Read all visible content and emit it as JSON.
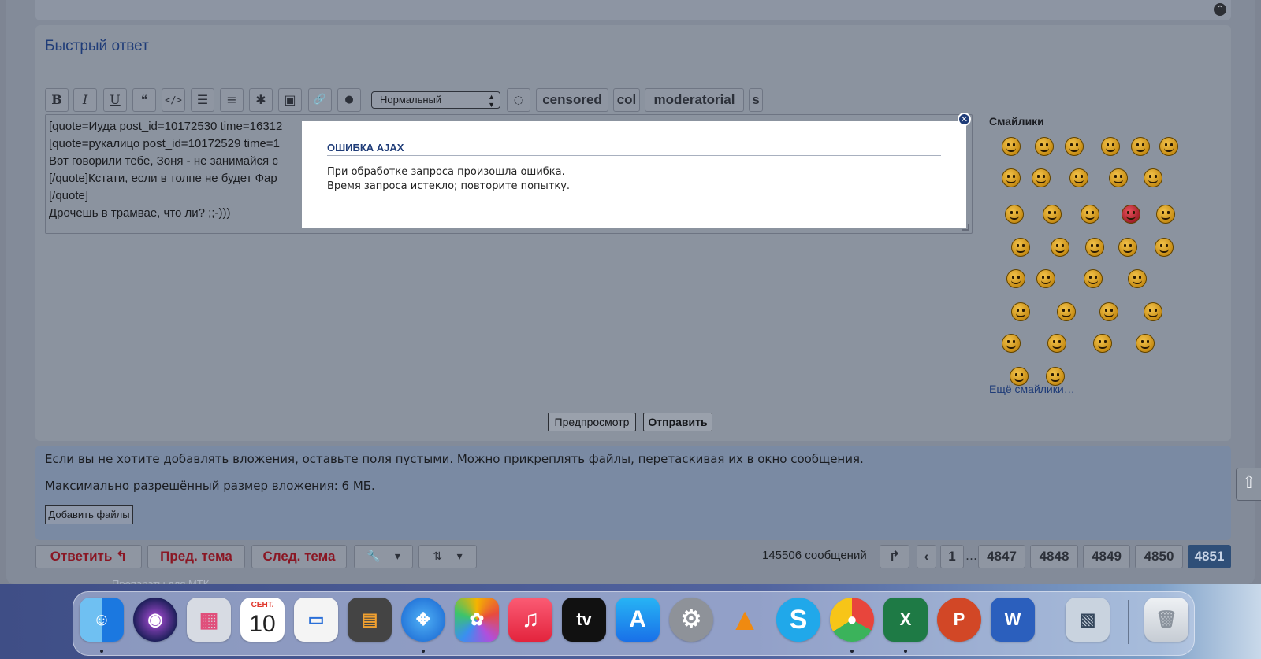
{
  "quick_reply": {
    "title": "Быстрый ответ",
    "toolbar": {
      "bold": "B",
      "italic": "I",
      "underline": "U",
      "quote": "❝",
      "code": "</>",
      "list": "☰",
      "olist": "≡",
      "spoiler": "✱",
      "image": "▣",
      "link": "🔗",
      "color": "●",
      "size_select": "Нормальный",
      "hide": "◌",
      "censored": "censored",
      "col": "col",
      "moderatorial": "moderatorial",
      "s": "s"
    },
    "editor_lines": [
      "[quote=Иуда post_id=10172530 time=16312",
      "[quote=рукалицо post_id=10172529 time=1",
      "Вот говорили тебе, Зоня - не занимайся с",
      "[/quote]Кстати, если в толпе не будет Фар",
      "[/quote]",
      "Дрочешь в трамвае, что ли? ;;-)))"
    ],
    "smilies_title": "Смайлики",
    "more_smilies": "Ещё смайлики…",
    "preview_label": "Предпросмотр",
    "submit_label": "Отправить"
  },
  "attachments": {
    "hint": "Если вы не хотите добавлять вложения, оставьте поля пустыми. Можно прикреплять файлы, перетаскивая их в окно сообщения.",
    "max_size": "Максимально разрешённый размер вложения: 6 МБ.",
    "add_files": "Добавить файлы"
  },
  "actions": {
    "reply": "Ответить ↰",
    "prev_topic": "Пред. тема",
    "next_topic": "След. тема",
    "wrench": "🔧",
    "sort": "⇅",
    "dropdown": "▾"
  },
  "pagination": {
    "message_count": "145506 сообщений",
    "jump": "↱",
    "prev": "‹",
    "pages": [
      "1",
      "4847",
      "4848",
      "4849",
      "4850",
      "4851"
    ],
    "ellipsis": "…",
    "active_page": "4851"
  },
  "under_text": "Препараты для МТК",
  "modal": {
    "title": "ОШИБКА AJAX",
    "line1": "При обработке запроса произошла ошибка.",
    "line2": "Время запроса истекло; повторите попытку.",
    "close": "✕"
  },
  "dock": {
    "calendar_month": "СЕНТ.",
    "calendar_day": "10",
    "apple_tv": "tv",
    "excel": "X",
    "powerpoint": "P",
    "word": "W",
    "skype": "S"
  },
  "colors": {
    "accent_blue": "#1f3c78",
    "action_red": "#8a1724",
    "active_page": "#2f4f78"
  }
}
